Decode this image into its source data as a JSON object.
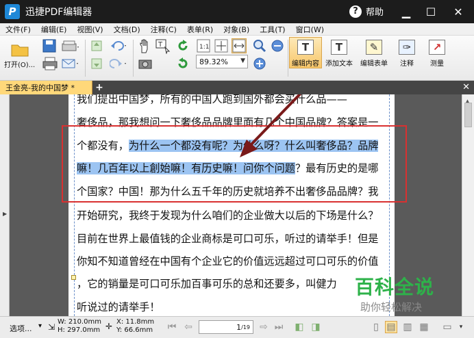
{
  "window": {
    "title": "迅捷PDF编辑器",
    "logo_letter": "P",
    "help_label": "帮助"
  },
  "menu": [
    "文件(F)",
    "编辑(E)",
    "视图(V)",
    "文档(D)",
    "注释(C)",
    "表单(R)",
    "对象(B)",
    "工具(T)",
    "窗口(W)"
  ],
  "toolbar": {
    "open_label": "打开(O)...",
    "zoom_value": "89.32%",
    "tools": [
      {
        "label": "编辑内容",
        "active": true
      },
      {
        "label": "添加文本",
        "active": false
      },
      {
        "label": "编辑表单",
        "active": false
      },
      {
        "label": "注释",
        "active": false
      },
      {
        "label": "测量",
        "active": false
      }
    ]
  },
  "tab": {
    "title": "王金亮-我的中国梦 *"
  },
  "document": {
    "lines": [
      {
        "plain": "我们提出中国梦，所有的中国人跑到国外都会买什么品——",
        "highlight": "",
        "after": ""
      },
      {
        "plain": "奢侈品，那我想问一下奢侈品品牌里面有几个中国品牌？答案是一",
        "highlight": "",
        "after": ""
      },
      {
        "plain": "个都没有，",
        "highlight": "为什么一个都没有呢？为什么呀？什么叫奢侈品？品牌",
        "after": ""
      },
      {
        "plain": "",
        "highlight": "嘛！几百年以上創始嘛！有历史嘛！问你个问题",
        "after": "？最有历史的是哪"
      },
      {
        "plain": "个国家？中国！那为什么五千年的历史就培养不出奢侈品品牌？我",
        "highlight": "",
        "after": ""
      },
      {
        "plain": "开始研究，我终于发现为什么咱们的企业做大以后的下场是什么？",
        "highlight": "",
        "after": ""
      },
      {
        "plain": "目前在世界上最值钱的企业商标是可口可乐，听过的请举手！但是",
        "highlight": "",
        "after": ""
      },
      {
        "plain": "你知不知道曾经在中国有个企业它的价值远远超过可口可乐的价值",
        "highlight": "",
        "after": ""
      },
      {
        "plain": "，它的销量是可口可乐加百事可乐的总和还要多，叫健力",
        "highlight": "",
        "after": ""
      },
      {
        "plain": "听说过的请举手！",
        "highlight": "",
        "after": ""
      }
    ]
  },
  "watermark": {
    "title": "百科全说",
    "subtitle": "助你轻松解决"
  },
  "status": {
    "select_label": "选项...",
    "width": "W: 210.0mm",
    "height": "H: 297.0mm",
    "x": "X:  11.8mm",
    "y": "Y:  66.6mm",
    "page_current": "1",
    "page_total": "/19"
  },
  "colors": {
    "highlight": "#9cc4f2",
    "annotation_red": "#d93030",
    "tab_active": "#ffd87a",
    "watermark_green": "#2eb24a"
  }
}
